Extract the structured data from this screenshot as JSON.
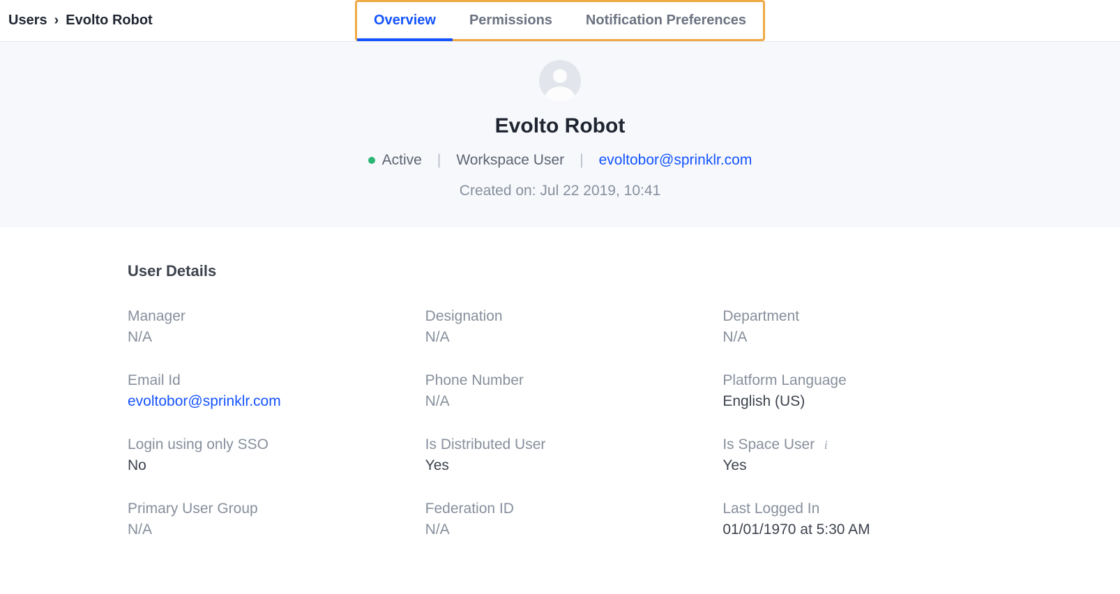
{
  "breadcrumb": {
    "root": "Users",
    "current": "Evolto Robot"
  },
  "tabs": {
    "overview": "Overview",
    "permissions": "Permissions",
    "notification_prefs": "Notification Preferences",
    "active": "overview"
  },
  "hero": {
    "name": "Evolto Robot",
    "status_text": "Active",
    "status_color": "#2bb673",
    "role": "Workspace User",
    "email": "evoltobor@sprinklr.com",
    "created_label": "Created on:",
    "created_value": "Jul 22 2019, 10:41"
  },
  "details": {
    "title": "User Details",
    "fields": {
      "manager": {
        "label": "Manager",
        "value": "N/A",
        "na": true
      },
      "designation": {
        "label": "Designation",
        "value": "N/A",
        "na": true
      },
      "department": {
        "label": "Department",
        "value": "N/A",
        "na": true
      },
      "email": {
        "label": "Email Id",
        "value": "evoltobor@sprinklr.com",
        "link": true
      },
      "phone": {
        "label": "Phone Number",
        "value": "N/A",
        "na": true
      },
      "language": {
        "label": "Platform Language",
        "value": "English (US)"
      },
      "sso_only": {
        "label": "Login using only SSO",
        "value": "No"
      },
      "distributed": {
        "label": "Is Distributed User",
        "value": "Yes"
      },
      "space_user": {
        "label": "Is Space User",
        "value": "Yes",
        "info": true
      },
      "primary_group": {
        "label": "Primary User Group",
        "value": "N/A",
        "na": true
      },
      "federation_id": {
        "label": "Federation ID",
        "value": "N/A",
        "na": true
      },
      "last_login": {
        "label": "Last Logged In",
        "value": "01/01/1970 at 5:30 AM"
      }
    }
  }
}
